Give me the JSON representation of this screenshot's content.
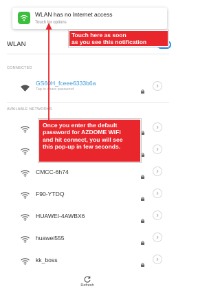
{
  "notification": {
    "title": "WLAN has no Internet access",
    "subtitle": "Touch for options",
    "icon": "wifi-warning-icon"
  },
  "callouts": {
    "top": [
      "Touch here as soon",
      "as you see this notification"
    ],
    "middle": [
      "Once you enter the default",
      "password for AZDOME WiFi",
      "and hit connect, you will see",
      "this pop-up in few seconds."
    ]
  },
  "wlan": {
    "title": "WLAN",
    "toggle_on": true
  },
  "sections": {
    "connected": "CONNECTED",
    "available": "AVAILABLE NETWORKS"
  },
  "connected_network": {
    "name": "GS60H_fceee6333b6a",
    "subtitle": "Tap to share password"
  },
  "networks": [
    {
      "name": "",
      "icon": "wifi-icon"
    },
    {
      "name": "",
      "icon": "wifi-icon"
    },
    {
      "name": "CMCC-6h74",
      "icon": "wifi-icon"
    },
    {
      "name": "F90-YTDQ",
      "icon": "wifi-icon"
    },
    {
      "name": "HUAWEI-4AWBX6",
      "icon": "wifi-icon"
    },
    {
      "name": "huawei555",
      "icon": "wifi-icon"
    },
    {
      "name": "kk_boss",
      "icon": "wifi-icon"
    }
  ],
  "refresh": {
    "label": "Refresh",
    "icon": "refresh-icon"
  },
  "colors": {
    "accent": "#2a90e8",
    "connected_text": "#3a9ad8",
    "callout": "#e8262c",
    "notification_icon": "#3cbf3c"
  }
}
